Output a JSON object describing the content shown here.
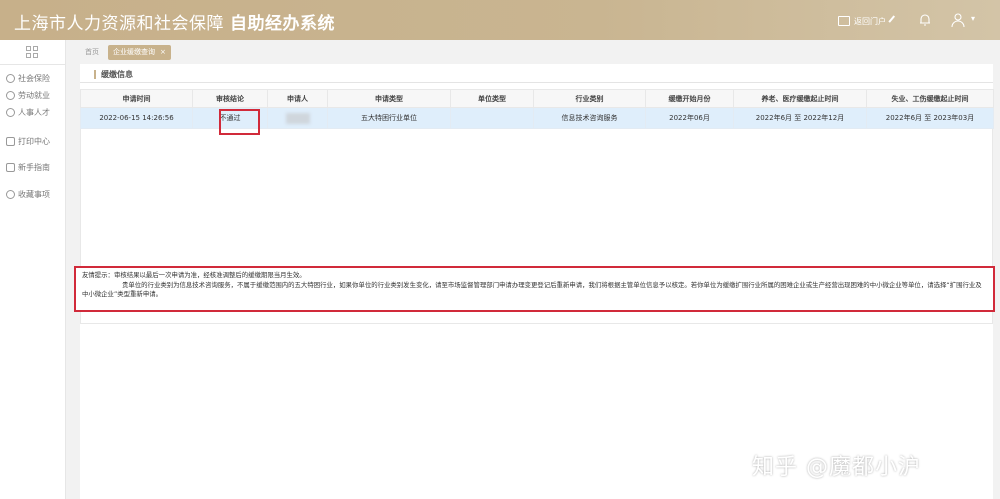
{
  "header": {
    "title": "上海市人力资源和社会保障",
    "subtitle": "自助经办系统",
    "portal_label": "返回门户",
    "colors": {
      "bar": "#c8b28c",
      "highlight": "#d12a3a",
      "row": "#dfeefb"
    }
  },
  "sidebar": {
    "items": [
      {
        "label": "社会保险",
        "icon": "shield-icon"
      },
      {
        "label": "劳动就业",
        "icon": "person-icon"
      },
      {
        "label": "人事人才",
        "icon": "people-icon"
      },
      {
        "label": "打印中心",
        "icon": "printer-icon"
      },
      {
        "label": "新手指南",
        "icon": "book-icon"
      },
      {
        "label": "收藏事项",
        "icon": "star-icon"
      }
    ]
  },
  "tabs": {
    "home": "首页",
    "active": "企业缓缴查询"
  },
  "panel": {
    "title": "缓缴信息"
  },
  "table": {
    "columns": [
      "申请时间",
      "审核结论",
      "申请人",
      "申请类型",
      "单位类型",
      "行业类别",
      "缓缴开始月份",
      "养老、医疗缓缴起止时间",
      "失业、工伤缓缴起止时间"
    ],
    "rows": [
      [
        "2022-06-15 14:26:56",
        "不通过",
        "",
        "五大特困行业单位",
        "",
        "信息技术咨询服务",
        "2022年06月",
        "2022年6月 至 2022年12月",
        "2022年6月 至 2023年03月"
      ]
    ]
  },
  "tip": {
    "line1": "友情提示：审核结果以最后一次申请为准，经核准调整后的缓缴期限当月生效。",
    "line2": "贵单位的行业类别为信息技术咨询服务，不属于缓缴范围内的五大特困行业，如果你单位的行业类别发生变化，请至市场监督管理部门申请办理变更登记后重新申请，我们将根据主管单位信息予以核定。若你单位为缓缴扩围行业所属的困难企业或生产经营出现困难的中小微企业等单位，请选择“扩围行业及中小微企业”类型重新申请。"
  },
  "watermark": "知乎 @魔都小沪"
}
